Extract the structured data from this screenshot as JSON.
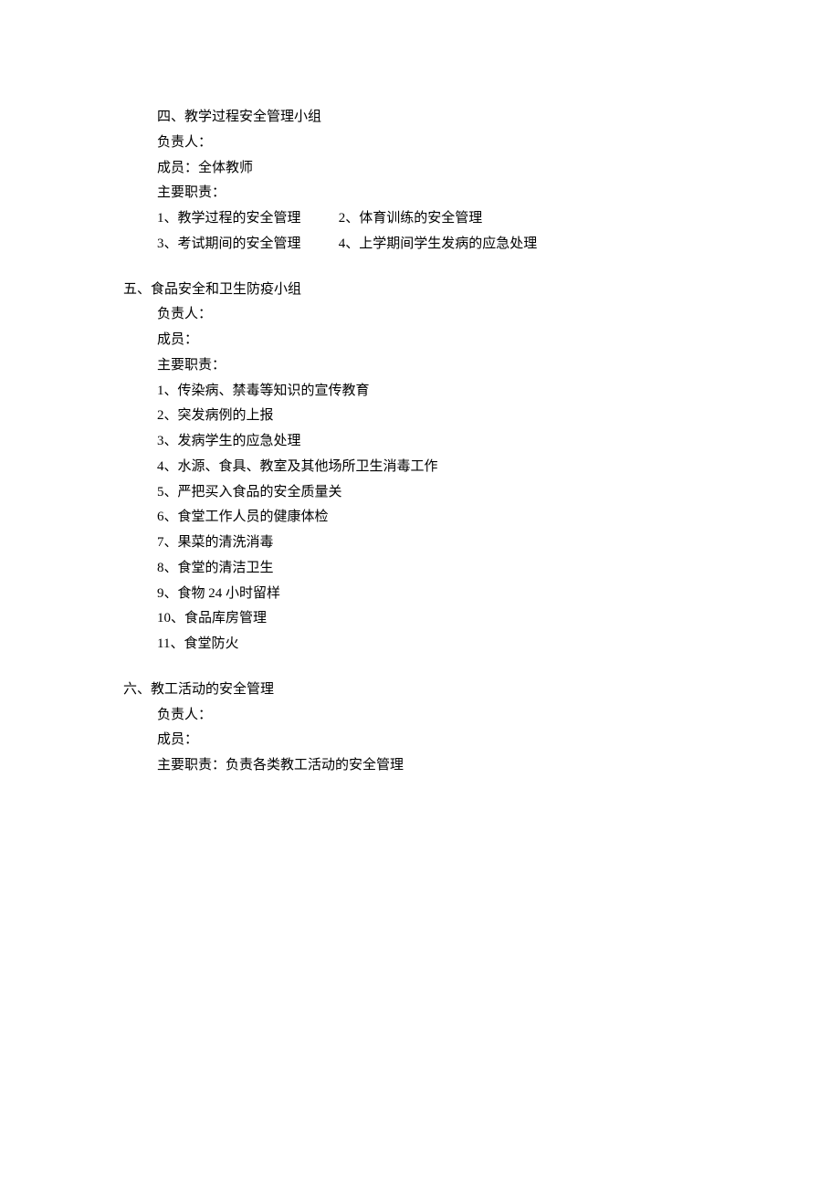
{
  "section4": {
    "title": "四、教学过程安全管理小组",
    "leader_label": "负责人：",
    "members_label": "成员：",
    "members_value": "全体教师",
    "duties_label": "主要职责：",
    "row1a": "1、教学过程的安全管理",
    "row1b": "2、体育训练的安全管理",
    "row2a": "3、考试期间的安全管理",
    "row2b": "4、上学期间学生发病的应急处理"
  },
  "section5": {
    "title": "五、食品安全和卫生防疫小组",
    "leader_label": "负责人：",
    "members_label": "成员：",
    "duties_label": "主要职责：",
    "d1": "1、传染病、禁毒等知识的宣传教育",
    "d2": "2、突发病例的上报",
    "d3": "3、发病学生的应急处理",
    "d4": "4、水源、食具、教室及其他场所卫生消毒工作",
    "d5": "5、严把买入食品的安全质量关",
    "d6": "6、食堂工作人员的健康体检",
    "d7": "7、果菜的清洗消毒",
    "d8": "8、食堂的清洁卫生",
    "d9": "9、食物 24 小时留样",
    "d10": "10、食品库房管理",
    "d11": "11、食堂防火"
  },
  "section6": {
    "title": "六、教工活动的安全管理",
    "leader_label": "负责人：",
    "members_label": "成员：",
    "duties_full": "主要职责：负责各类教工活动的安全管理"
  }
}
